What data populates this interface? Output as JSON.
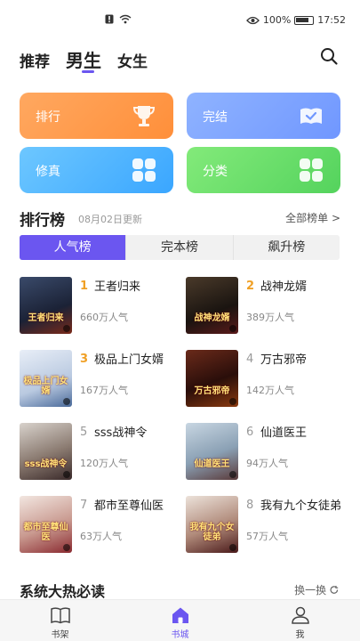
{
  "status_bar": {
    "battery": "100%",
    "time": "17:52"
  },
  "top_tabs": [
    "推荐",
    "男生",
    "女生"
  ],
  "top_tab_active": 1,
  "quick_buttons": {
    "rank": "排行",
    "finish": "完结",
    "xiuzhen": "修真",
    "category": "分类"
  },
  "ranking": {
    "title": "排行榜",
    "updated": "08月02日更新",
    "more": "全部榜单 >",
    "tabs": [
      "人气榜",
      "完本榜",
      "飙升榜"
    ],
    "active_tab": 0,
    "books": [
      {
        "rank": "1",
        "title": "王者归来",
        "popularity": "660万人气"
      },
      {
        "rank": "2",
        "title": "战神龙婿",
        "popularity": "389万人气"
      },
      {
        "rank": "3",
        "title": "极品上门女婿",
        "popularity": "167万人气"
      },
      {
        "rank": "4",
        "title": "万古邪帝",
        "popularity": "142万人气"
      },
      {
        "rank": "5",
        "title": "sss战神令",
        "popularity": "120万人气"
      },
      {
        "rank": "6",
        "title": "仙道医王",
        "popularity": "94万人气"
      },
      {
        "rank": "7",
        "title": "都市至尊仙医",
        "popularity": "63万人气"
      },
      {
        "rank": "8",
        "title": "我有九个女徒弟",
        "popularity": "57万人气"
      }
    ]
  },
  "hot_section": {
    "title": "系统大热必读",
    "change": "换一换"
  },
  "bottom_nav": {
    "items": [
      "书架",
      "书城",
      "我"
    ],
    "active": 1
  },
  "colors": {
    "accent": "#6b56f0",
    "rank_top": "#f0a025"
  }
}
